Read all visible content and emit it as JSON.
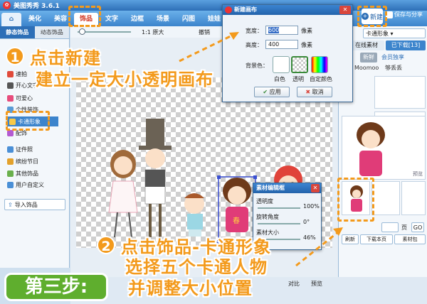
{
  "app": {
    "title": "美图秀秀 3.6.1"
  },
  "tabs": [
    "美化",
    "美容",
    "饰品",
    "文字",
    "边框",
    "场景",
    "闪图",
    "娃娃"
  ],
  "header": {
    "new_label": "新建",
    "save_label": "保存与分享"
  },
  "left_panel": {
    "tabs": [
      "静态饰品",
      "动态饰品"
    ],
    "items": [
      "速拍",
      "开心文字",
      "可爱心",
      "个性装饰",
      "卡通形象",
      "配饰",
      "证件照",
      "缤纷节日",
      "其他饰品",
      "用户自定义"
    ],
    "import_label": "导入饰品"
  },
  "canvas_toolbar": {
    "zoom_label": "1:1 原大",
    "undo_label": "撤销"
  },
  "new_canvas_dialog": {
    "title": "新建画布",
    "width_label": "宽度：",
    "width_value": "600",
    "width_unit": "像素",
    "height_label": "高度：",
    "height_value": "400",
    "height_unit": "像素",
    "bg_label": "背景色：",
    "colors": [
      "白色",
      "透明",
      "自定颜色"
    ],
    "apply_label": "应用",
    "cancel_label": "取消"
  },
  "material_dialog": {
    "title": "素材编辑框",
    "opacity_label": "透明度",
    "opacity_value": "100%",
    "rotate_label": "旋转角度",
    "rotate_value": "0°",
    "size_label": "素材大小",
    "size_value": "46%"
  },
  "right_panel": {
    "category": "卡通形象",
    "tabs": [
      "在线素材",
      "已下载[13]"
    ],
    "filters": [
      "新鲜",
      "会员独享",
      "Moomoo",
      "够丢丢"
    ],
    "preview_label": "预览",
    "pager_label": "页",
    "go_label": "GO",
    "bottom_buttons": [
      "刷新",
      "下载本页",
      "素材包"
    ]
  },
  "statusbar": {
    "compare_label": "对比",
    "preview_label": "预览"
  },
  "annotations": {
    "step1_number": "1",
    "step1_line1": "点击新建",
    "step1_line2": "建立一定大小透明画布",
    "step2_number": "2",
    "step2_line1": "点击饰品-卡通形象",
    "step2_line2": "选择五个卡通人物",
    "step2_line3": "并调整大小位置",
    "step3_label": "第三步:"
  },
  "colors": {
    "accent": "#f39a1c",
    "step_green": "#5fae2e",
    "window_blue": "#2d6fb7"
  }
}
